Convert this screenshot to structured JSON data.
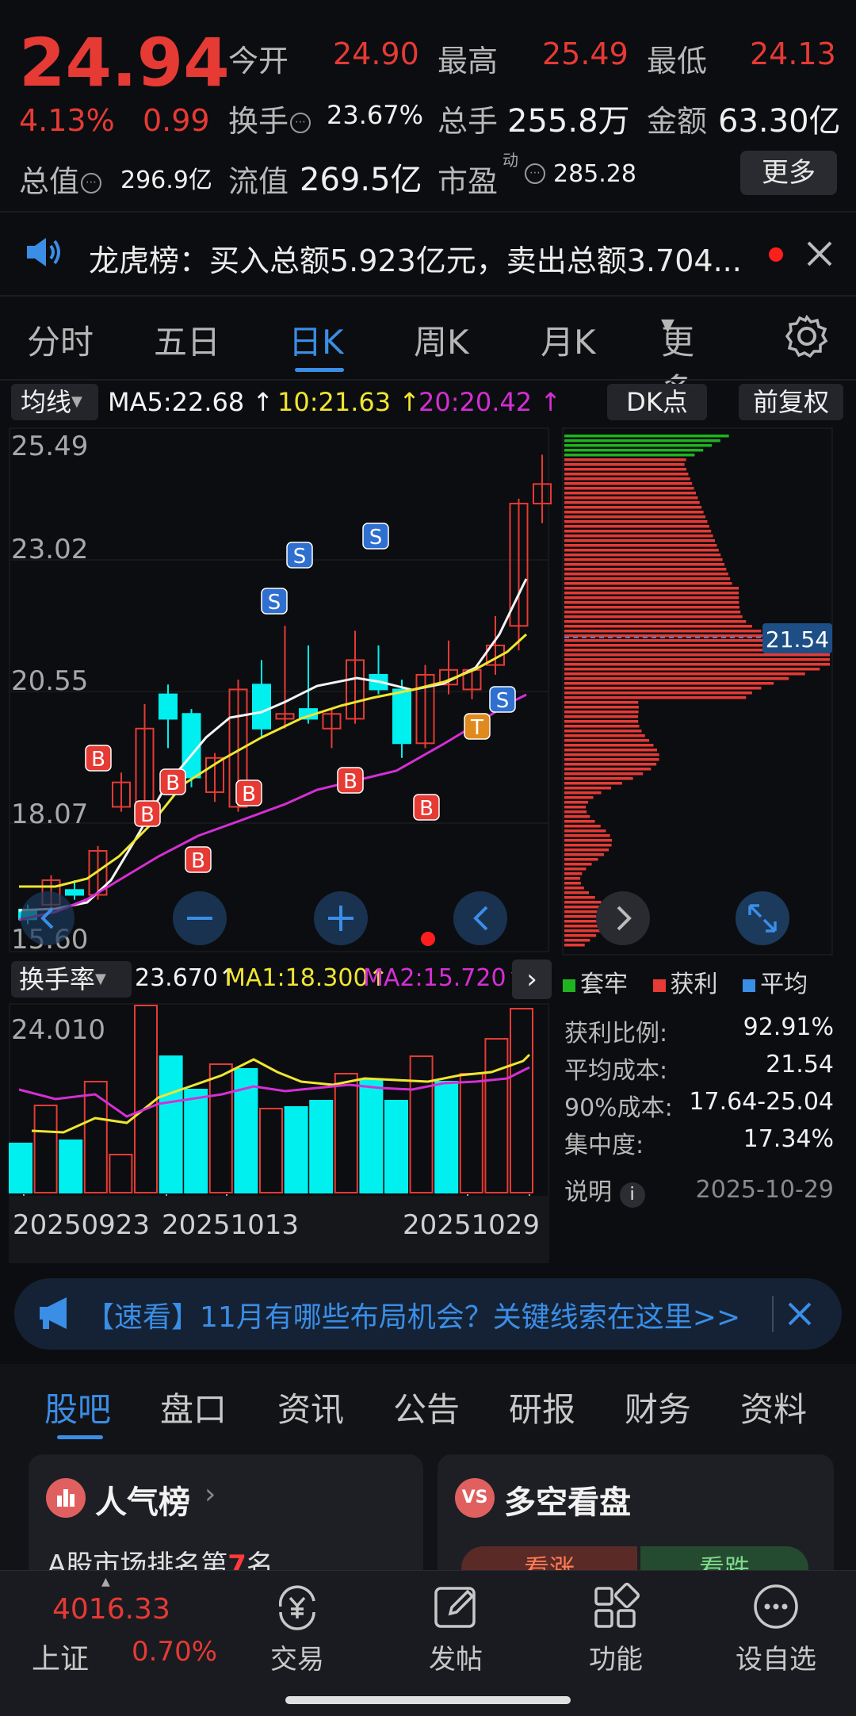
{
  "quote": {
    "price": "24.94",
    "change_pct": "4.13%",
    "change_abs": "0.99",
    "open_label": "今开",
    "open_val": "24.90",
    "high_label": "最高",
    "high_val": "25.49",
    "low_label": "最低",
    "low_val": "24.13",
    "turnover_label": "换手",
    "turnover_val": "23.67%",
    "volume_label": "总手",
    "volume_val": "255.8万",
    "amount_label": "金额",
    "amount_val": "63.30亿",
    "mktcap_label": "总值",
    "mktcap_val": "296.9亿",
    "float_label": "流值",
    "float_val": "269.5亿",
    "pe_label": "市盈",
    "pe_sup": "动",
    "pe_val": "285.28",
    "more_label": "更多"
  },
  "notice": {
    "text": "龙虎榜：买入总额5.923亿元，卖出总额3.704..."
  },
  "chart_tabs": [
    "分时",
    "五日",
    "日K",
    "周K",
    "月K",
    "更多"
  ],
  "chart_tab_active": 2,
  "ma_bar": {
    "dropdown": "均线",
    "ma5": "MA5:22.68",
    "ma10": "10:21.63",
    "ma20": "20:20.42",
    "dk": "DK点",
    "fq": "前复权"
  },
  "price_axis": [
    "25.49",
    "23.02",
    "20.55",
    "18.07",
    "15.60"
  ],
  "cost_marker": "21.54",
  "turnover_bar": {
    "dropdown": "换手率",
    "val": "23.670",
    "ma1": "MA1:18.300",
    "ma2": "MA2:15.720",
    "axis_top": "24.010"
  },
  "dates": [
    "20250923",
    "20251013",
    "20251029"
  ],
  "chip": {
    "legend": [
      "套牢",
      "获利",
      "平均"
    ],
    "rows": [
      {
        "label": "获利比例:",
        "value": "92.91%"
      },
      {
        "label": "平均成本:",
        "value": "21.54"
      },
      {
        "label": "90%成本:",
        "value": "17.64-25.04"
      },
      {
        "label": "集中度:",
        "value": "17.34%"
      }
    ],
    "explain": "说明",
    "date": "2025-10-29"
  },
  "promo": {
    "text": "【速看】11月有哪些布局机会？关键线索在这里>>"
  },
  "bottom_tabs": [
    "股吧",
    "盘口",
    "资讯",
    "公告",
    "研报",
    "财务",
    "资料"
  ],
  "cards": {
    "left_title": "人气榜",
    "left_sub_pre": "A股市场排名第",
    "left_sub_rank": "7",
    "left_sub_post": "名",
    "right_title": "多空看盘",
    "rise": "看涨",
    "fall": "看跌"
  },
  "nav": {
    "index_val": "4016.33",
    "index_name": "上证",
    "index_pct": "0.70%",
    "items": [
      "交易",
      "发帖",
      "功能",
      "设自选"
    ]
  },
  "colors": {
    "up": "#e63a35",
    "down": "#00f0f0",
    "accent": "#3a8ee6"
  }
}
